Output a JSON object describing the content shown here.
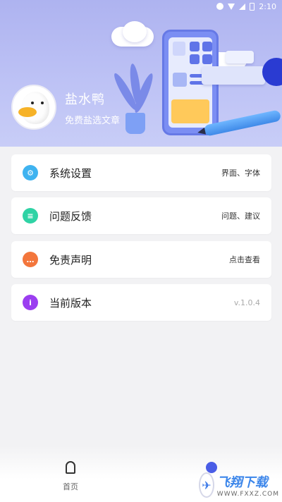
{
  "status_bar": {
    "time": "2:10"
  },
  "profile": {
    "name": "盐水鸭",
    "subtitle": "免费盐选文章"
  },
  "menu": [
    {
      "label": "系统设置",
      "right": "界面、字体",
      "icon": "gear-icon",
      "color": "#3fb3f0"
    },
    {
      "label": "问题反馈",
      "right": "问题、建议",
      "icon": "feedback-icon",
      "color": "#2fd3a5"
    },
    {
      "label": "免责声明",
      "right": "点击查看",
      "icon": "chat-icon",
      "color": "#f3763c"
    },
    {
      "label": "当前版本",
      "right": "v.1.0.4",
      "icon": "info-icon",
      "color": "#9b3ef0"
    }
  ],
  "bottom_nav": {
    "home_label": "首页"
  },
  "watermark": {
    "title": "飞翔下载",
    "sub": "WWW.FXXZ.COM"
  },
  "colors": {
    "header_bg": "#b6bbf3",
    "accent": "#4a5de6"
  }
}
